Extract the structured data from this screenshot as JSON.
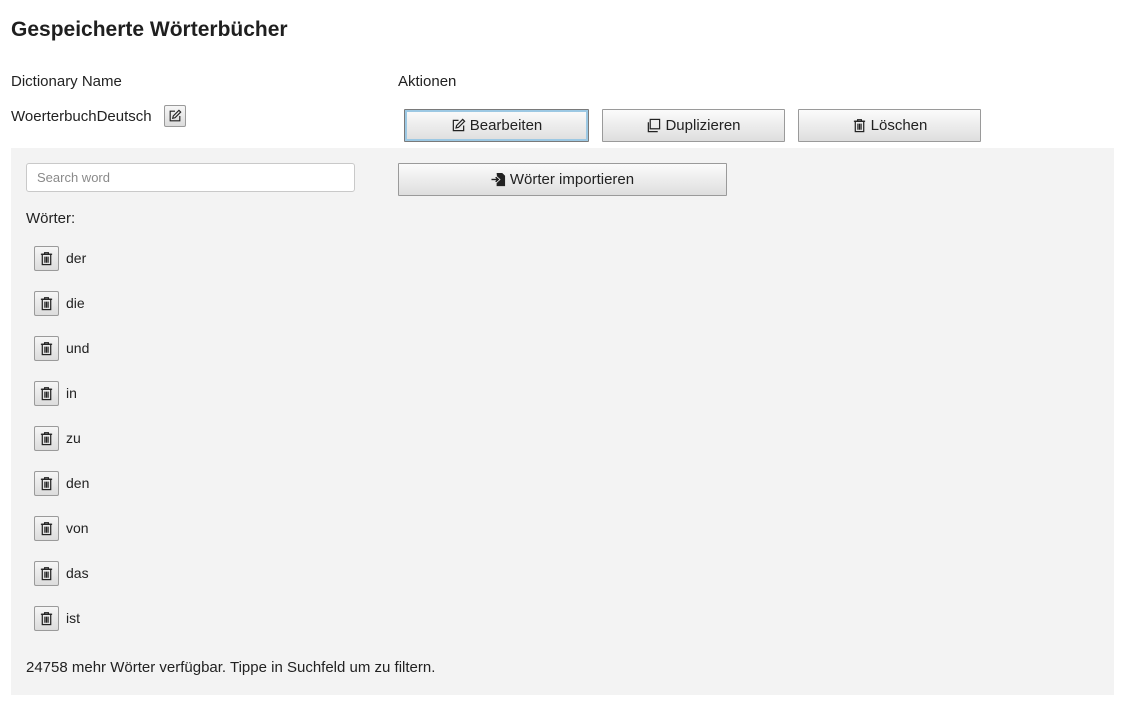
{
  "header": {
    "title": "Gespeicherte Wörterbücher"
  },
  "table": {
    "col_name": "Dictionary Name",
    "col_actions": "Aktionen"
  },
  "dictionary": {
    "name": "WoerterbuchDeutsch"
  },
  "actions": {
    "edit_label": "Bearbeiten",
    "duplicate_label": "Duplizieren",
    "delete_label": "Löschen"
  },
  "panel": {
    "search_placeholder": "Search word",
    "search_value": "",
    "import_label": "Wörter importieren",
    "words_label": "Wörter:",
    "words": [
      "der",
      "die",
      "und",
      "in",
      "zu",
      "den",
      "von",
      "das",
      "ist"
    ],
    "more_note": "24758 mehr Wörter verfügbar. Tippe in Suchfeld um zu filtern."
  },
  "icons": {
    "rename": "edit-icon",
    "edit": "edit-icon",
    "duplicate": "copy-icon",
    "delete": "trash-icon",
    "import": "file-import-icon",
    "word_delete": "trash-icon"
  }
}
